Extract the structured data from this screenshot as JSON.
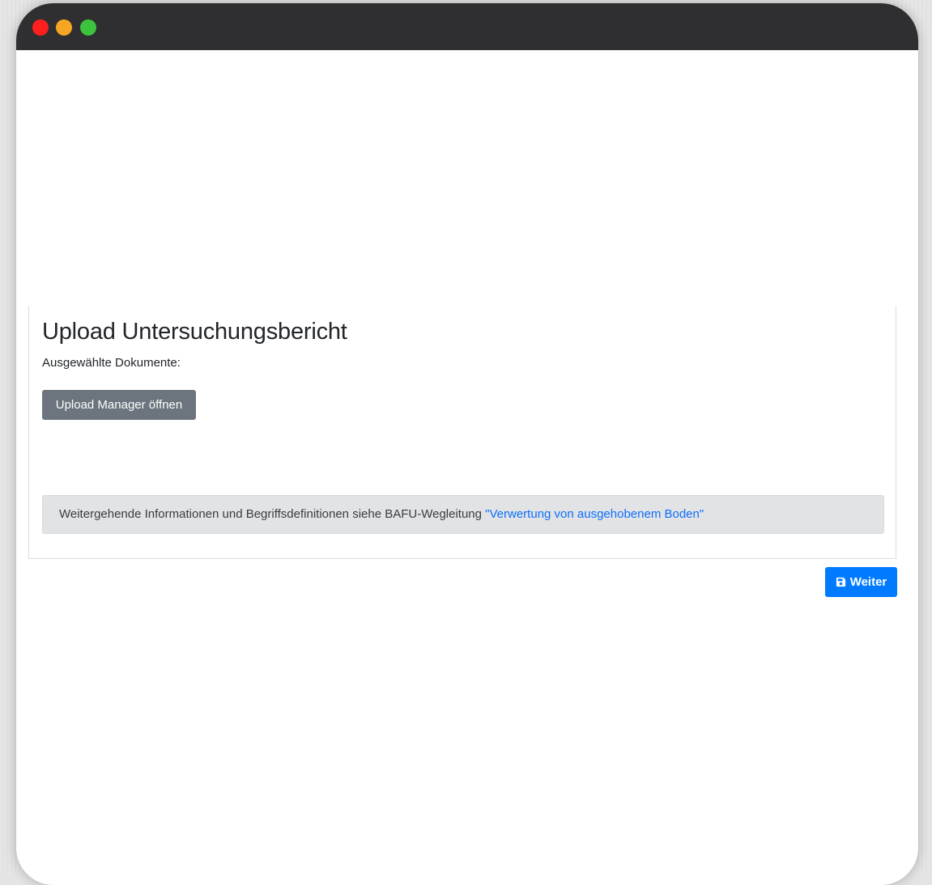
{
  "window": {
    "buttons": {
      "close_color": "#ff1f1f",
      "minimize_color": "#f5a623",
      "maximize_color": "#3cc23c"
    }
  },
  "form": {
    "title": "Upload Untersuchungsbericht",
    "selected_documents_label": "Ausgewählte Dokumente:",
    "upload_button_label": "Upload Manager öffnen"
  },
  "info": {
    "text": "Weitergehende Informationen und Begriffsdefinitionen siehe BAFU-Wegleitung ",
    "link_text": "\"Verwertung von ausgehobenem Boden\""
  },
  "footer": {
    "next_button_label": "Weiter",
    "next_button_icon": "save-icon"
  },
  "colors": {
    "primary": "#007bff",
    "secondary": "#6c757d",
    "info_bg": "#e2e3e5",
    "link": "#0d6efd",
    "titlebar": "#2f2f31"
  }
}
